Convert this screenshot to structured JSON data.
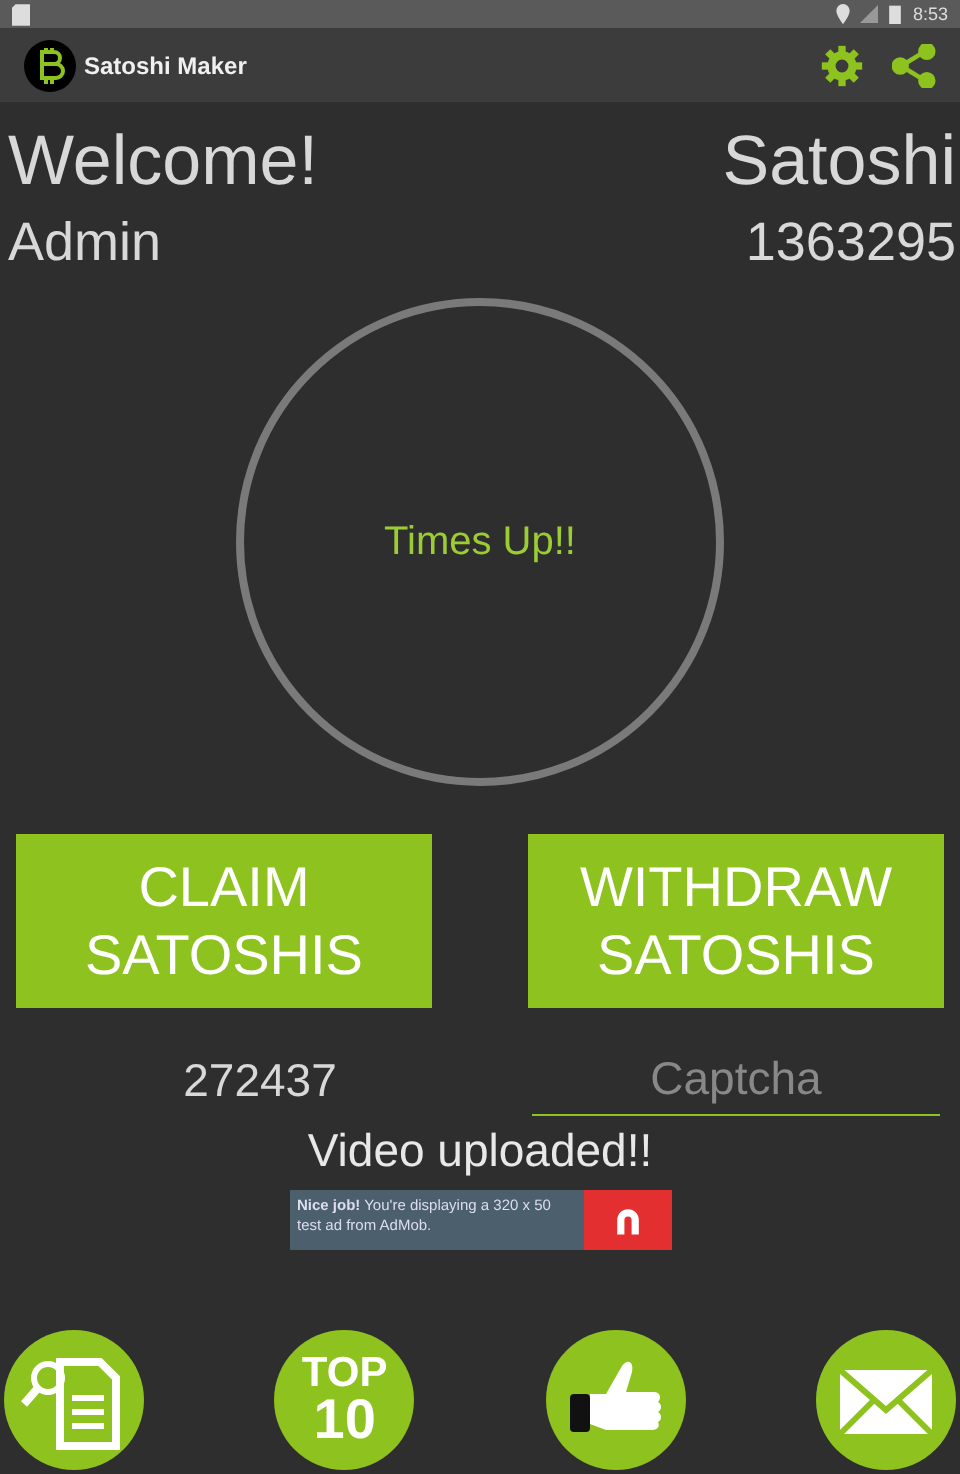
{
  "status_bar": {
    "time": "8:53"
  },
  "app_bar": {
    "title": "Satoshi Maker"
  },
  "header": {
    "greeting": "Welcome!",
    "username": "Admin",
    "balance_label": "Satoshi",
    "balance": "1363295"
  },
  "timer": {
    "text": "Times Up!!"
  },
  "buttons": [
    {
      "label": "CLAIM SATOSHIS"
    },
    {
      "label": "WITHDRAW SATOSHIS"
    }
  ],
  "captcha": {
    "code": "272437",
    "placeholder": "Captcha"
  },
  "message": "Video uploaded!!",
  "ad": {
    "text": "**Nice job!** You're displaying a 320 x 50 test ad from AdMob."
  },
  "bottom_nav": [
    {
      "kind": "document"
    },
    {
      "kind": "top10",
      "line1": "TOP",
      "line2": "10"
    },
    {
      "kind": "thumbs"
    },
    {
      "kind": "mail"
    }
  ]
}
